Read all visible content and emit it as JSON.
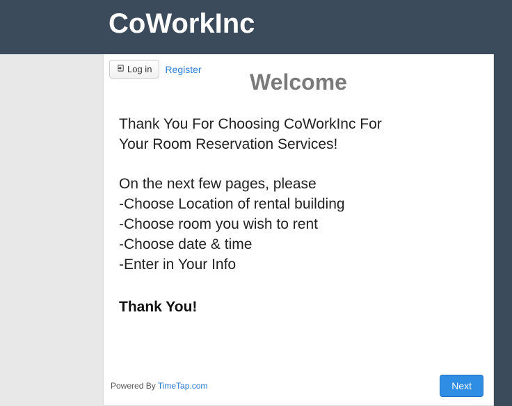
{
  "header": {
    "brand": "CoWorkInc"
  },
  "toolbar": {
    "login_label": "Log in",
    "register_label": "Register"
  },
  "main": {
    "title": "Welcome",
    "intro_line1": "Thank You For Choosing CoWorkInc For",
    "intro_line2": "Your Room Reservation Services!",
    "instr_lead": "On the next few pages, please",
    "step1": "-Choose Location of rental building",
    "step2": "-Choose room you wish to rent",
    "step3": "-Choose date & time",
    "step4": "-Enter in Your Info",
    "thanks": "Thank You!"
  },
  "footer": {
    "powered_prefix": "Powered By ",
    "powered_link": "TimeTap.com",
    "next_label": "Next"
  }
}
